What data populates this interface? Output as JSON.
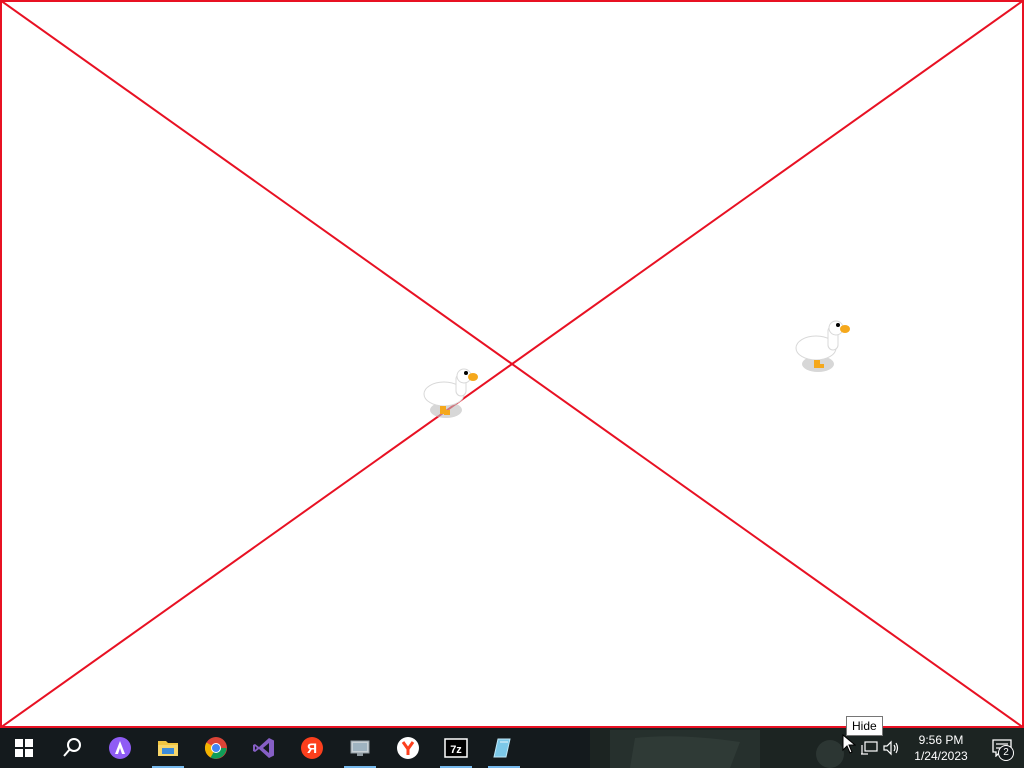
{
  "desktop": {
    "placeholder_color": "#e81123",
    "geese": [
      {
        "name": "goose-left"
      },
      {
        "name": "goose-right"
      }
    ]
  },
  "tooltip": {
    "text": "Hide"
  },
  "taskbar": {
    "apps": [
      {
        "name": "start-button",
        "icon": "windows-icon"
      },
      {
        "name": "search-button",
        "icon": "search-icon"
      },
      {
        "name": "alice-assistant",
        "icon": "alice-icon"
      },
      {
        "name": "file-explorer",
        "icon": "folder-icon"
      },
      {
        "name": "chrome",
        "icon": "chrome-icon"
      },
      {
        "name": "visual-studio",
        "icon": "visual-studio-icon"
      },
      {
        "name": "yandex",
        "icon": "yandex-icon"
      },
      {
        "name": "monitor-app",
        "icon": "monitor-icon"
      },
      {
        "name": "yandex-browser",
        "icon": "yandex-browser-icon"
      },
      {
        "name": "7zip",
        "icon": "7z-icon",
        "label": "7z"
      },
      {
        "name": "notepad-app",
        "icon": "notepad-icon"
      }
    ],
    "clock": {
      "time": "9:56 PM",
      "date": "1/24/2023"
    },
    "notifications": {
      "count": "2"
    }
  }
}
